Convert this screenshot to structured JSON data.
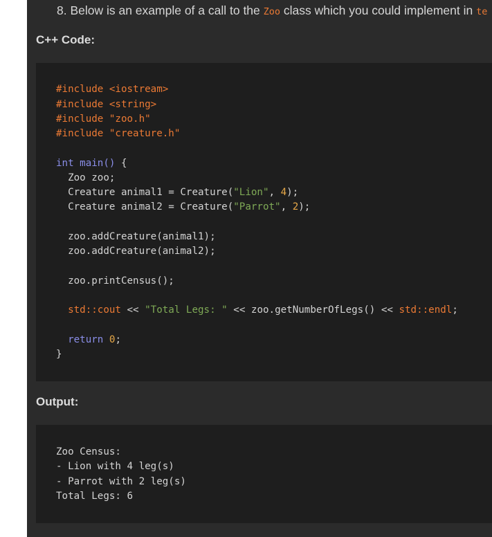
{
  "question": {
    "text_before": "8. Below is an example of a call to the ",
    "class_name": "Zoo",
    "text_after": " class which you could implement in ",
    "trailing_code": "te"
  },
  "code_section": {
    "heading": "C++ Code:",
    "lines": {
      "l1_pp": "#include ",
      "l1_hdr": "<iostream>",
      "l2_pp": "#include ",
      "l2_hdr": "<string>",
      "l3_pp": "#include ",
      "l3_hdr": "\"zoo.h\"",
      "l4_pp": "#include ",
      "l4_hdr": "\"creature.h\"",
      "l5_kw": "int",
      "l5_fn": " main()",
      "l5_rest": " {",
      "l6": "  Zoo zoo;",
      "l7_a": "  Creature animal1 = Creature(",
      "l7_str": "\"Lion\"",
      "l7_b": ", ",
      "l7_num": "4",
      "l7_c": ");",
      "l8_a": "  Creature animal2 = Creature(",
      "l8_str": "\"Parrot\"",
      "l8_b": ", ",
      "l8_num": "2",
      "l8_c": ");",
      "l9": "  zoo.addCreature(animal1);",
      "l10": "  zoo.addCreature(animal2);",
      "l11": "  zoo.printCensus();",
      "l12_ns1": "  std::cout",
      "l12_a": " << ",
      "l12_str": "\"Total Legs: \"",
      "l12_b": " << zoo.getNumberOfLegs() << ",
      "l12_ns2": "std::endl",
      "l12_c": ";",
      "l13_kw": "  return",
      "l13_sp": " ",
      "l13_num": "0",
      "l13_c": ";",
      "l14": "}"
    }
  },
  "output_section": {
    "heading": "Output:",
    "lines": [
      "Zoo Census:",
      "- Lion with 4 leg(s)",
      "- Parrot with 2 leg(s)",
      "Total Legs: 6"
    ]
  },
  "colors": {
    "panel_bg": "#2b2b2b",
    "code_bg": "#1e1e1e",
    "preprocessor": "#ec7a34",
    "keyword": "#8a8ee8",
    "string": "#7faa56",
    "number": "#e8a948"
  }
}
